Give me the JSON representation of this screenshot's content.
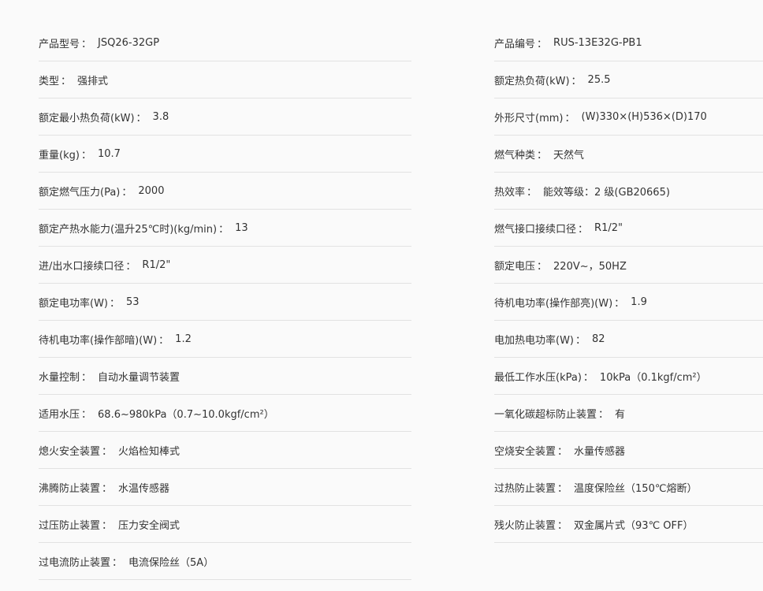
{
  "separator": "：",
  "left_specs": [
    {
      "label": "产品型号",
      "value": "JSQ26-32GP"
    },
    {
      "label": "类型",
      "value": "强排式"
    },
    {
      "label": "额定最小热负荷(kW)",
      "value": "3.8"
    },
    {
      "label": "重量(kg)",
      "value": "10.7"
    },
    {
      "label": "额定燃气压力(Pa)",
      "value": "2000"
    },
    {
      "label": "额定产热水能力(温升25℃时)(kg/min)",
      "value": "13"
    },
    {
      "label": "进/出水口接续口径",
      "value": "R1/2\""
    },
    {
      "label": "额定电功率(W)",
      "value": "53"
    },
    {
      "label": "待机电功率(操作部暗)(W)",
      "value": "1.2"
    },
    {
      "label": "水量控制",
      "value": "自动水量调节装置"
    },
    {
      "label": "适用水压",
      "value": "68.6~980kPa（0.7~10.0kgf/cm²）"
    },
    {
      "label": "熄火安全装置",
      "value": "火焰检知棒式"
    },
    {
      "label": "沸腾防止装置",
      "value": "水温传感器"
    },
    {
      "label": "过压防止装置",
      "value": "压力安全阀式"
    },
    {
      "label": "过电流防止装置",
      "value": "电流保险丝（5A）"
    }
  ],
  "right_specs": [
    {
      "label": "产品编号",
      "value": "RUS-13E32G-PB1"
    },
    {
      "label": "额定热负荷(kW)",
      "value": "25.5"
    },
    {
      "label": "外形尺寸(mm)",
      "value": "(W)330×(H)536×(D)170"
    },
    {
      "label": "燃气种类",
      "value": "天然气"
    },
    {
      "label": "热效率",
      "value": "能效等级：2 级(GB20665)"
    },
    {
      "label": "燃气接口接续口径",
      "value": "R1/2\""
    },
    {
      "label": "额定电压",
      "value": "220V~，50HZ"
    },
    {
      "label": "待机电功率(操作部亮)(W)",
      "value": "1.9"
    },
    {
      "label": "电加热电功率(W)",
      "value": "82"
    },
    {
      "label": "最低工作水压(kPa)",
      "value": "10kPa（0.1kgf/cm²）"
    },
    {
      "label": "一氧化碳超标防止装置",
      "value": "有"
    },
    {
      "label": "空烧安全装置",
      "value": "水量传感器"
    },
    {
      "label": "过热防止装置",
      "value": "温度保险丝（150℃熔断）"
    },
    {
      "label": "残火防止装置",
      "value": "双金属片式（93℃ OFF）"
    }
  ]
}
